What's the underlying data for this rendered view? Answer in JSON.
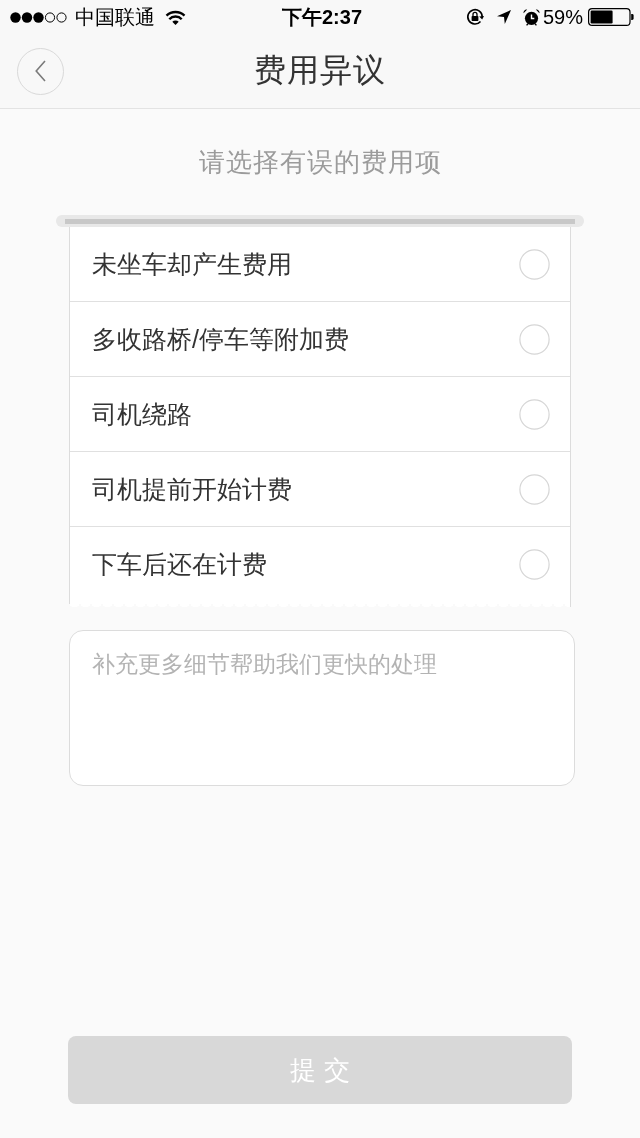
{
  "status_bar": {
    "carrier": "中国联通",
    "time": "下午2:37",
    "battery": "59%"
  },
  "nav_bar": {
    "title": "费用异议"
  },
  "prompt": "请选择有误的费用项",
  "fee_items": [
    {
      "label": "未坐车却产生费用",
      "selected": false
    },
    {
      "label": "多收路桥/停车等附加费",
      "selected": false
    },
    {
      "label": "司机绕路",
      "selected": false
    },
    {
      "label": "司机提前开始计费",
      "selected": false
    },
    {
      "label": "下车后还在计费",
      "selected": false
    }
  ],
  "note": {
    "placeholder": "补充更多细节帮助我们更快的处理"
  },
  "submit_button": {
    "label": "提 交",
    "disabled": true
  }
}
